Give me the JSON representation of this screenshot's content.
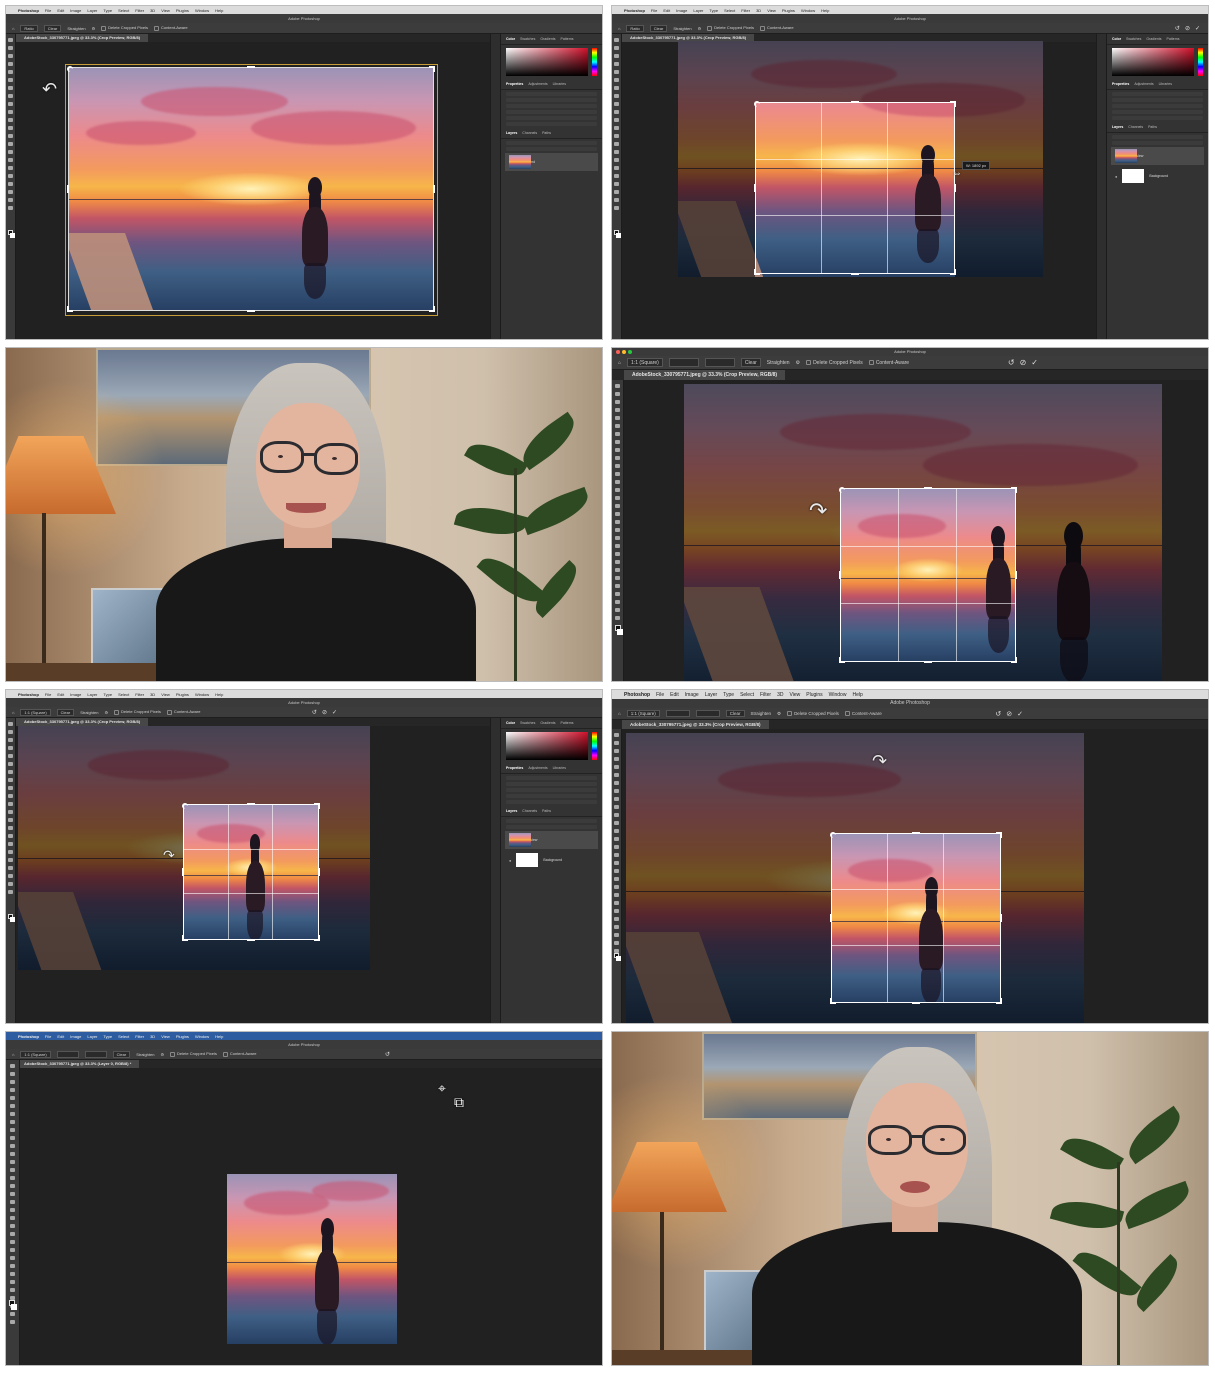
{
  "photoshop": {
    "app_name": "Photoshop",
    "menu_items": [
      "File",
      "Edit",
      "Image",
      "Layer",
      "Type",
      "Select",
      "Filter",
      "3D",
      "View",
      "Plugins",
      "Window",
      "Help"
    ],
    "window_title": "Adobe Photoshop",
    "tab_crop_preview": "AdobeStock_330795771.jpeg @ 33.3% (Crop Preview, RGB/8)",
    "tab_layer0": "AdobeStock_330795771.jpeg @ 33.3% (Layer 0, RGB/8) *",
    "ratio_preset": "1:1 (Square)",
    "clear_label": "Clear",
    "straighten_label": "Straighten",
    "delete_cropped_label": "Delete Cropped Pixels",
    "content_aware_label": "Content-Aware",
    "panel_tabs_top": [
      "Color",
      "Swatches",
      "Gradients",
      "Patterns"
    ],
    "panel_tabs_mid": [
      "Properties",
      "Adjustments",
      "Libraries"
    ],
    "panel_tabs_layers": [
      "Layers",
      "Channels",
      "Paths"
    ],
    "layer_crop_preview": "Crop Preview",
    "layer_background": "Background",
    "tooltip_width": "W: 1892 px",
    "icons": [
      "rotate-cursor-icon",
      "move-crop-cursor-icon",
      "reset-icon",
      "cancel-icon",
      "commit-check-icon",
      "home-icon",
      "gear-icon",
      "eye-icon",
      "apple-icon"
    ]
  }
}
